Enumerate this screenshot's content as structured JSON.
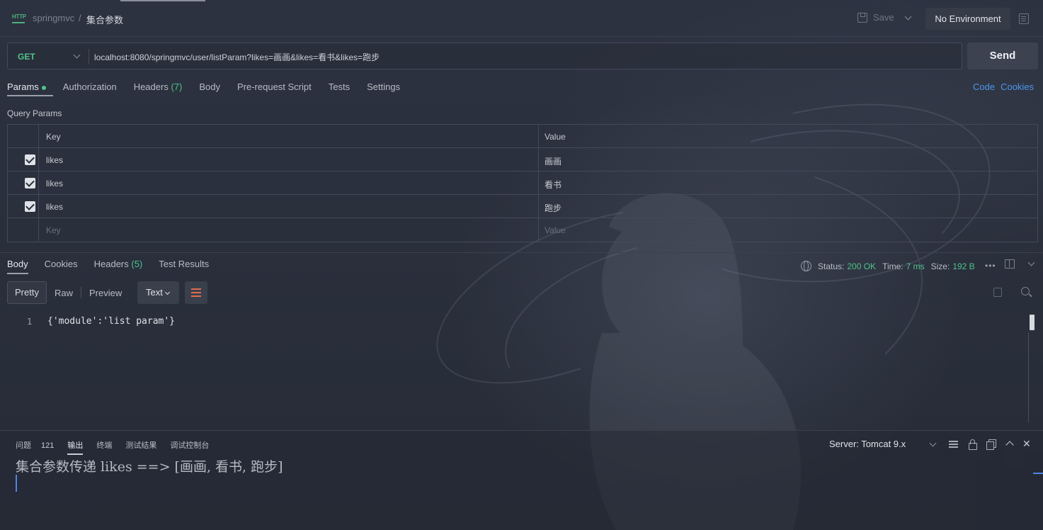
{
  "header": {
    "project": "springmvc",
    "separator": "/",
    "current": "集合参数",
    "save_label": "Save",
    "environment": "No Environment"
  },
  "request": {
    "method": "GET",
    "url": "localhost:8080/springmvc/user/listParam?likes=画画&likes=看书&likes=跑步",
    "send_label": "Send"
  },
  "request_tabs": [
    {
      "label": "Params",
      "active": true
    },
    {
      "label": "Authorization"
    },
    {
      "label": "Headers",
      "count": "(7)"
    },
    {
      "label": "Body"
    },
    {
      "label": "Pre-request Script"
    },
    {
      "label": "Tests"
    },
    {
      "label": "Settings"
    }
  ],
  "right_links": {
    "code": "Code",
    "cookies": "Cookies"
  },
  "query_params": {
    "title": "Query Params",
    "columns": {
      "key": "Key",
      "value": "Value"
    },
    "rows": [
      {
        "key": "likes",
        "value": "画画",
        "checked": true
      },
      {
        "key": "likes",
        "value": "看书",
        "checked": true
      },
      {
        "key": "likes",
        "value": "跑步",
        "checked": true
      }
    ],
    "placeholder": {
      "key": "Key",
      "value": "Value"
    }
  },
  "response_tabs": [
    {
      "label": "Body",
      "active": true
    },
    {
      "label": "Cookies"
    },
    {
      "label": "Headers",
      "count": "(5)"
    },
    {
      "label": "Test Results"
    }
  ],
  "response_status": {
    "status_label": "Status:",
    "status": "200 OK",
    "time_label": "Time:",
    "time": "7 ms",
    "size_label": "Size:",
    "size": "192 B",
    "more": "•••"
  },
  "format_toolbar": {
    "pretty": "Pretty",
    "raw": "Raw",
    "preview": "Preview",
    "type": "Text"
  },
  "response_body": {
    "line_number": "1",
    "content": "{'module':'list param'}"
  },
  "console": {
    "tabs": [
      {
        "label": "问题",
        "badge": "121"
      },
      {
        "label": "输出",
        "active": true
      },
      {
        "label": "终端"
      },
      {
        "label": "测试结果"
      },
      {
        "label": "调试控制台"
      }
    ],
    "server": "Server: Tomcat 9.x",
    "output": "集合参数传递 likes ==> [画画, 看书, 跑步]",
    "close": "✕"
  },
  "colors": {
    "accent_green": "#4fc38a",
    "link_blue": "#4d96ec",
    "wrap_orange": "#e06c4f"
  }
}
